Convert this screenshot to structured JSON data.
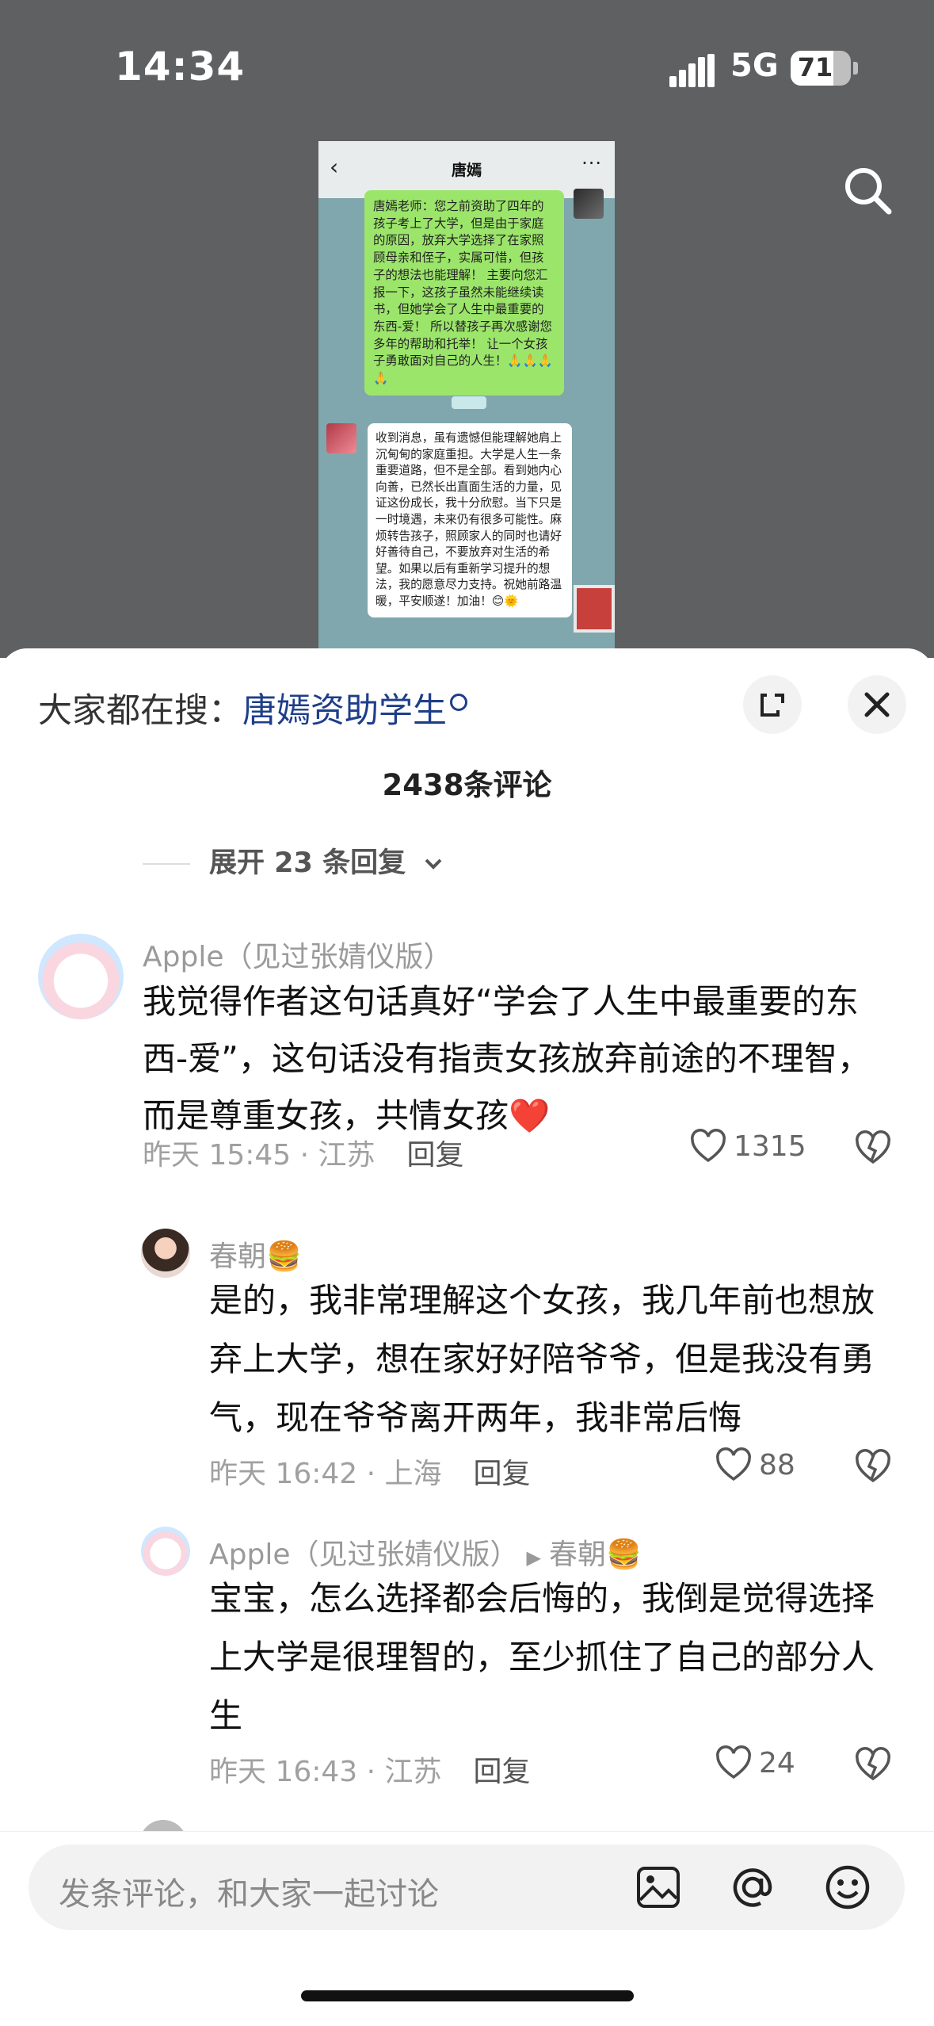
{
  "status_bar": {
    "time": "14:34",
    "network": "5G",
    "battery": "71",
    "battery_level": 0.71
  },
  "screenshot_chat": {
    "title": "唐嫣",
    "back": "‹",
    "more": "···",
    "message_out": "唐嫣老师：您之前资助了四年的孩子考上了大学，但是由于家庭的原因，放弃大学选择了在家照顾母亲和侄子，实属可惜，但孩子的想法也能理解！ 主要向您汇报一下，这孩子虽然未能继续读书，但她学会了人生中最重要的东西-爱！ 所以替孩子再次感谢您多年的帮助和托举！ 让一个女孩子勇敢面对自己的人生！🙏🙏🙏🙏",
    "message_in": "收到消息，虽有遗憾但能理解她肩上沉甸甸的家庭重担。大学是人生一条重要道路，但不是全部。看到她内心向善，已然长出直面生活的力量，见证这份成长，我十分欣慰。当下只是一时境遇，未来仍有很多可能性。麻烦转告孩子，照顾家人的同时也请好好善待自己，不要放弃对生活的希望。如果以后有重新学习提升的想法，我的愿意尽力支持。祝她前路温暖，平安顺遂！加油！😊🌞"
  },
  "sheet": {
    "trending_prefix": "大家都在搜：",
    "trending_keyword": "唐嫣资助学生",
    "comment_count": "2438条评论",
    "expand_replies": "展开 23 条回复"
  },
  "comments": [
    {
      "user": "Apple（见过张婧仪版）",
      "text": "我觉得作者这句话真好“学会了人生中最重要的东西-爱”，这句话没有指责女孩放弃前途的不理智，而是尊重女孩，共情女孩",
      "emoji": "❤️",
      "time_loc": "昨天 15:45 · 江苏",
      "reply_label": "回复",
      "likes": "1315"
    },
    {
      "user": "春朝",
      "user_emoji": "🍔",
      "text": "是的，我非常理解这个女孩，我几年前也想放弃上大学，想在家好好陪爷爷，但是我没有勇气，现在爷爷离开两年，我非常后悔",
      "time_loc": "昨天 16:42 · 上海",
      "reply_label": "回复",
      "likes": "88"
    },
    {
      "user": "Apple（见过张婧仪版）",
      "reply_to": "春朝",
      "reply_to_emoji": "🍔",
      "text": "宝宝，怎么选择都会后悔的，我倒是觉得选择上大学是很理智的，至少抓住了自己的部分人生",
      "time_loc": "昨天 16:43 · 江苏",
      "reply_label": "回复",
      "likes": "24"
    }
  ],
  "input": {
    "placeholder": "发条评论，和大家一起讨论"
  }
}
